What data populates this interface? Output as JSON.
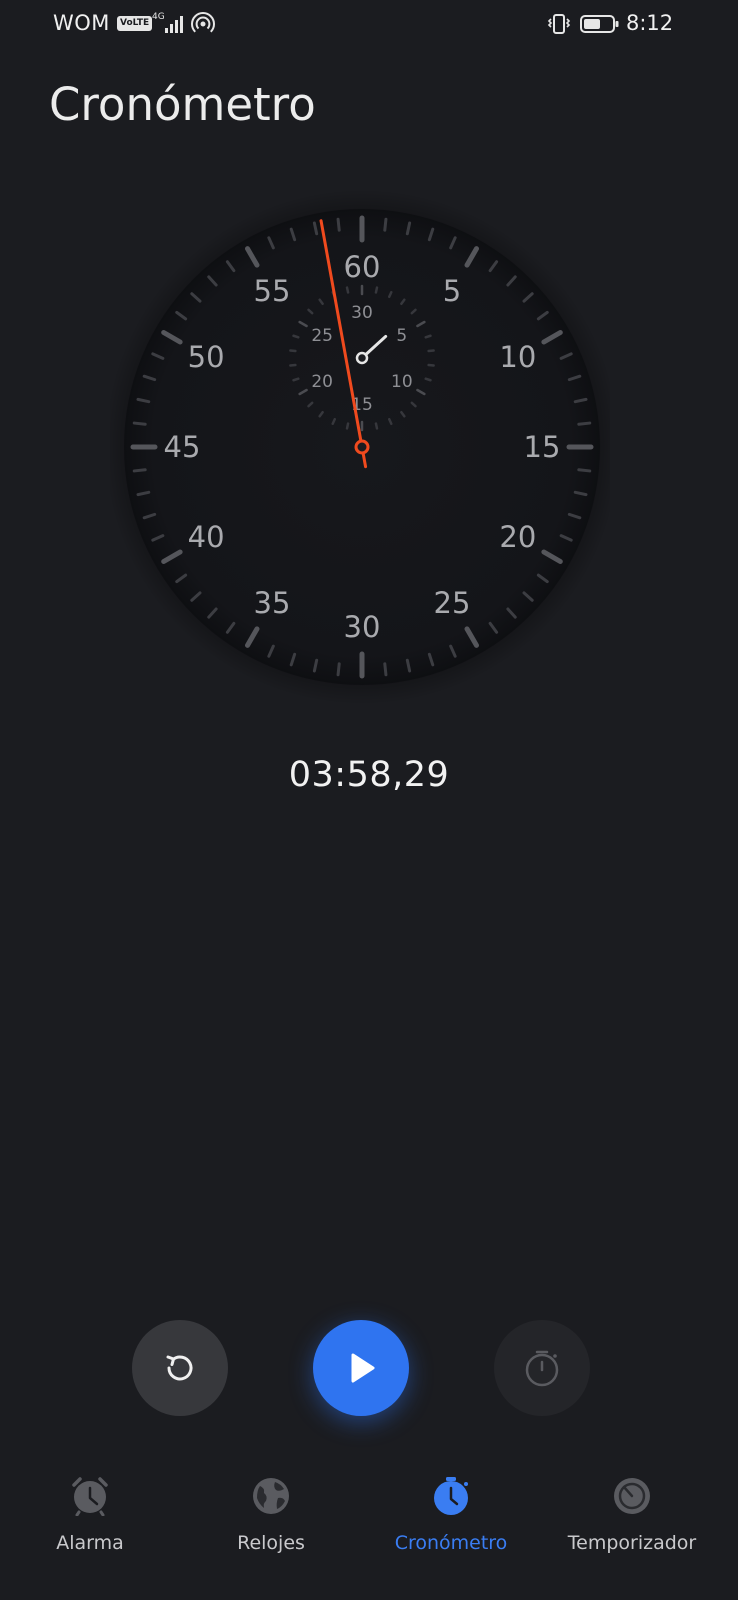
{
  "status_bar": {
    "carrier": "WOM",
    "volte": "VoLTE",
    "network": "4G",
    "time": "8:12"
  },
  "page": {
    "title": "Cronómetro"
  },
  "stopwatch": {
    "elapsed": "03:58,29",
    "main_dial_labels": [
      "60",
      "5",
      "10",
      "15",
      "20",
      "25",
      "30",
      "35",
      "40",
      "45",
      "50",
      "55"
    ],
    "sub_dial_labels": [
      "30",
      "5",
      "10",
      "15",
      "20",
      "25"
    ],
    "seconds_hand_value": 58.29,
    "minutes_hand_value": 3.97,
    "hand_color": "#f04a1e"
  },
  "controls": {
    "reset_icon": "reset-icon",
    "start_icon": "play-icon",
    "lap_icon": "stopwatch-icon",
    "accent": "#2f74f0"
  },
  "nav": {
    "items": [
      {
        "label": "Alarma",
        "icon": "alarm-clock-icon"
      },
      {
        "label": "Relojes",
        "icon": "globe-icon"
      },
      {
        "label": "Cronómetro",
        "icon": "stopwatch-icon"
      },
      {
        "label": "Temporizador",
        "icon": "timer-icon"
      }
    ],
    "active_color": "#3a7df2"
  }
}
